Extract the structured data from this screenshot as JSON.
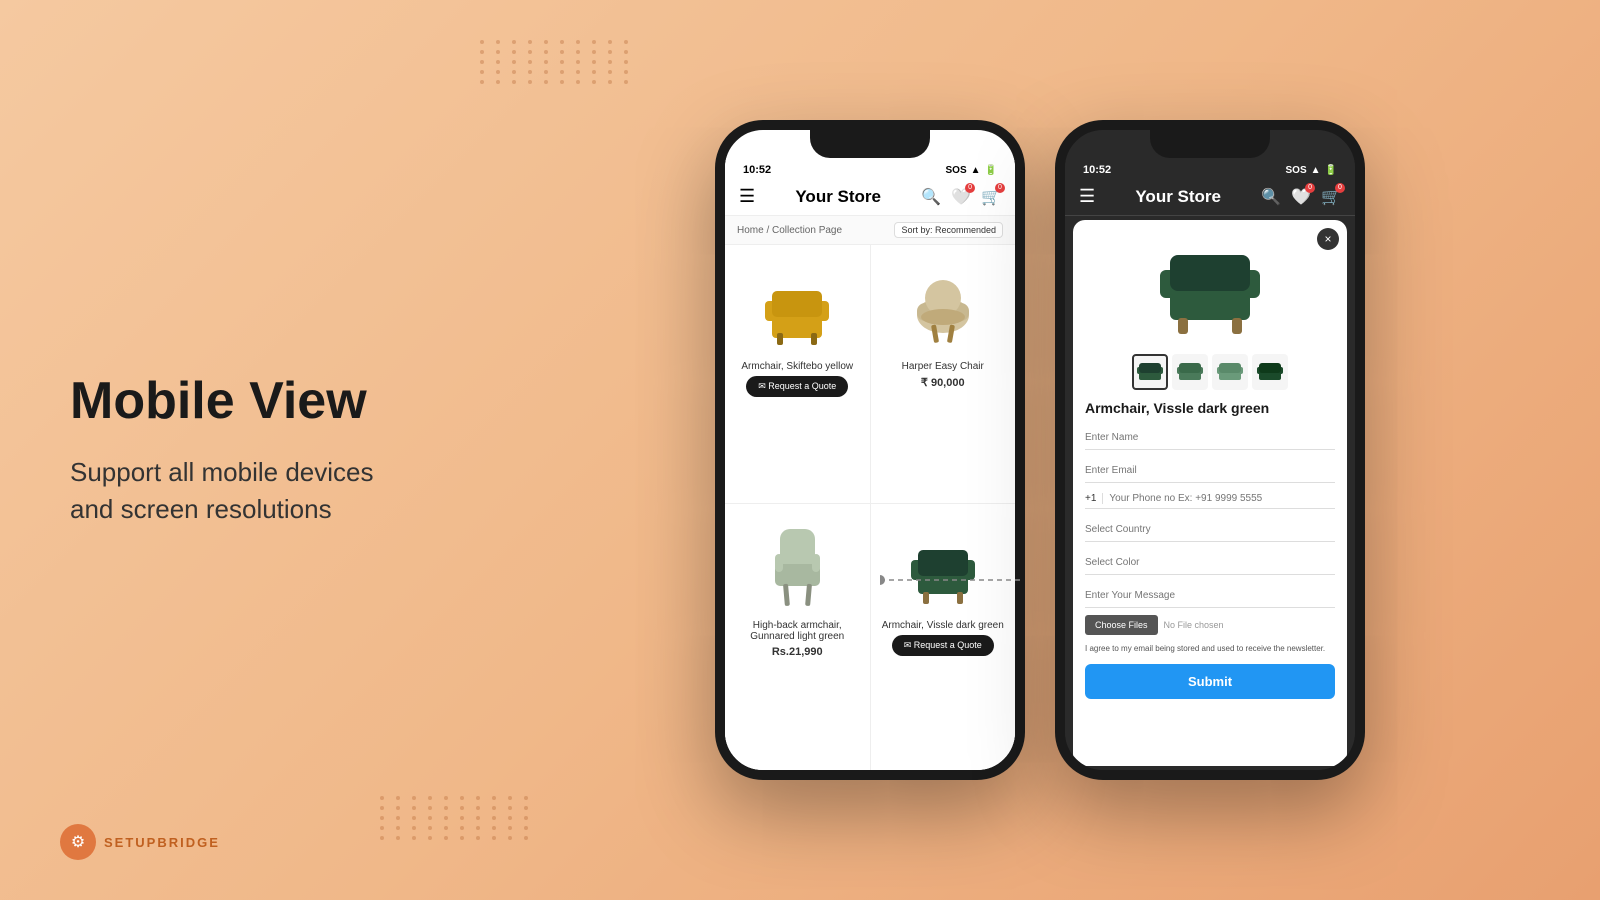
{
  "left": {
    "main_title": "Mobile View",
    "sub_title": "Support all mobile devices\nand screen resolutions",
    "brand_name": "SETUPBRIDGE"
  },
  "phone_light": {
    "status_bar": {
      "time": "10:52",
      "sos": "SOS",
      "battery": "▮▮▮"
    },
    "navbar": {
      "title": "Your Store",
      "menu_icon": "☰"
    },
    "breadcrumb": "Home / Collection Page",
    "sort_label": "Sort by: Recommended",
    "products": [
      {
        "name": "Armchair, Skiftebo yellow",
        "price": "",
        "has_button": true,
        "button_label": "✉ Request a Quote",
        "color": "yellow"
      },
      {
        "name": "Harper Easy Chair",
        "price": "₹ 90,000",
        "has_button": false,
        "color": "beige"
      },
      {
        "name": "High-back armchair, Gunnared light green",
        "price": "Rs.21,990",
        "has_button": false,
        "color": "light-green"
      },
      {
        "name": "Armchair, Vissle dark green",
        "price": "",
        "has_button": true,
        "button_label": "✉ Request a Quote",
        "color": "dark-green"
      }
    ]
  },
  "phone_dark": {
    "status_bar": {
      "time": "10:52",
      "sos": "SOS"
    },
    "navbar": {
      "title": "Your Store"
    },
    "modal": {
      "product_title": "Armchair, Vissle dark green",
      "close_button": "×",
      "form_fields": [
        {
          "label": "Enter Name",
          "type": "text"
        },
        {
          "label": "Enter Email",
          "type": "email"
        },
        {
          "label": "Select Country",
          "type": "select"
        },
        {
          "label": "Select Color",
          "type": "select"
        },
        {
          "label": "Enter Your Message",
          "type": "text"
        }
      ],
      "phone_placeholder": "Your Phone no Ex: +91 9999 5555",
      "country_code": "+1",
      "choose_files_label": "Choose Files",
      "no_file_label": "No File chosen",
      "consent_text": "I agree to my email being stored and used to receive the newsletter.",
      "submit_label": "Submit"
    }
  }
}
